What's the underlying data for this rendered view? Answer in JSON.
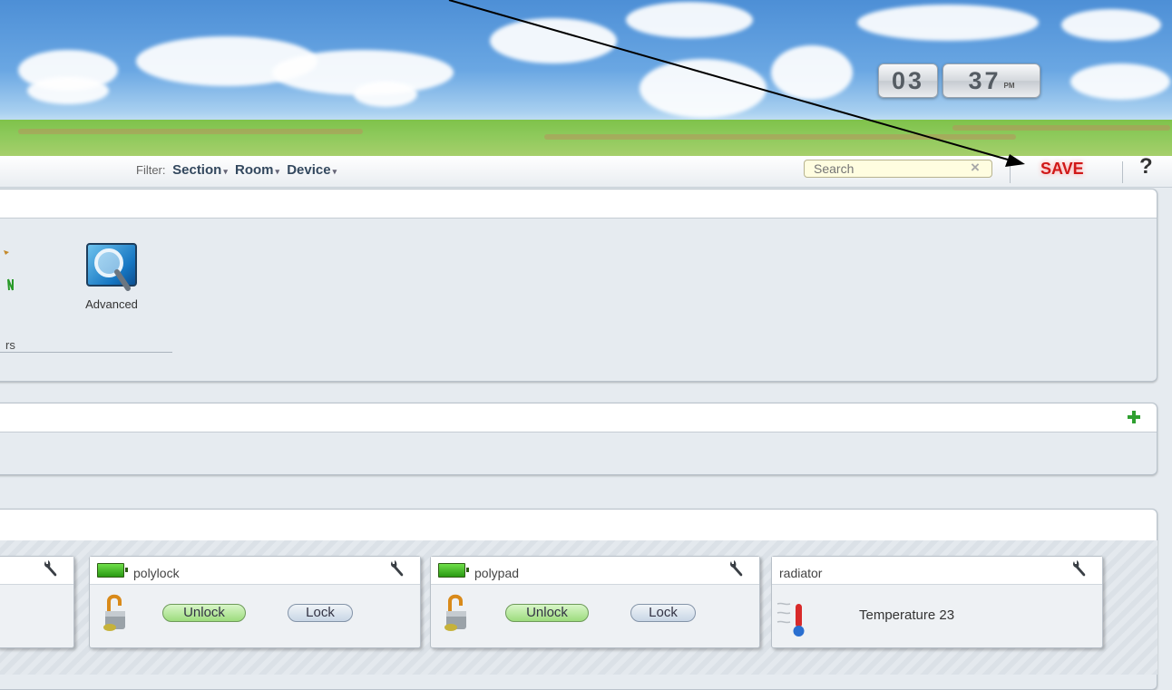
{
  "clock": {
    "hours": "03",
    "minutes": "37",
    "ampm": "PM"
  },
  "filter": {
    "label": "Filter:",
    "section": "Section",
    "room": "Room",
    "device": "Device",
    "caret": "▾"
  },
  "search": {
    "placeholder": "Search",
    "clear": "×"
  },
  "save_label": "SAVE",
  "help_label": "?",
  "tools": {
    "partial_label": "rs",
    "advanced_label": "Advanced"
  },
  "devices": [
    {
      "name": "polylock",
      "unlock_label": "Unlock",
      "lock_label": "Lock"
    },
    {
      "name": "polypad",
      "unlock_label": "Unlock",
      "lock_label": "Lock"
    },
    {
      "name": "radiator",
      "status": "Temperature 23"
    }
  ]
}
